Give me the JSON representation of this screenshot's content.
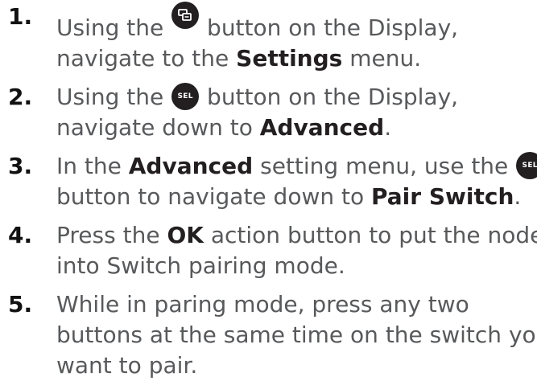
{
  "steps": [
    {
      "num": "1.",
      "l1_before": "Using the ",
      "l1_icon": "display-menu-button-icon",
      "l1_after": " button on the Display,",
      "l2_before": "navigate to the ",
      "l2_bold": "Settings",
      "l2_after": " menu."
    },
    {
      "num": "2.",
      "l1_before": "Using the ",
      "l1_icon_label": "SEL",
      "l1_after": " button on the Display,",
      "l2_before": "navigate down to ",
      "l2_bold": "Advanced",
      "l2_after": "."
    },
    {
      "num": "3.",
      "l1_before": "In the ",
      "l1_bold": "Advanced",
      "l1_mid": " setting menu, use the ",
      "l1_icon_label": "SEL",
      "l2_before": "button to navigate down to ",
      "l2_bold": "Pair Switch",
      "l2_after": "."
    },
    {
      "num": "4.",
      "l1_before": "Press the ",
      "l1_bold": "OK",
      "l1_after": " action button to put the node",
      "l2": "into Switch pairing mode."
    },
    {
      "num": "5.",
      "l1": "While in paring mode, press any two",
      "l2": "buttons at the same time on the switch you",
      "l3": "want to pair."
    }
  ],
  "colors": {
    "text": "#58595b",
    "number": "#111111",
    "bold": "#231f20",
    "icon_bg": "#231f20"
  }
}
